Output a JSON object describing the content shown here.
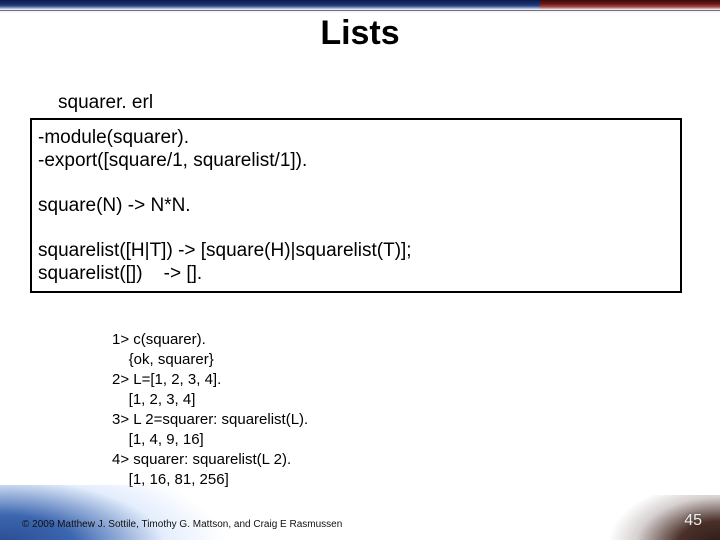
{
  "title": "Lists",
  "filename": "squarer. erl",
  "code": {
    "l1": "-module(squarer).",
    "l2": "-export([square/1, squarelist/1]).",
    "l3": "square(N) -> N*N.",
    "l4": "squarelist([H|T]) -> [square(H)|squarelist(T)];",
    "l5": "squarelist([])    -> []."
  },
  "shell": {
    "s1": "1> c(squarer).",
    "s2": "    {ok, squarer}",
    "s3": "2> L=[1, 2, 3, 4].",
    "s4": "    [1, 2, 3, 4]",
    "s5": "3> L 2=squarer: squarelist(L).",
    "s6": "    [1, 4, 9, 16]",
    "s7": "4> squarer: squarelist(L 2).",
    "s8": "    [1, 16, 81, 256]"
  },
  "copyright": "© 2009 Matthew J. Sottile, Timothy G. Mattson, and Craig E Rasmussen",
  "pagenum": "45"
}
